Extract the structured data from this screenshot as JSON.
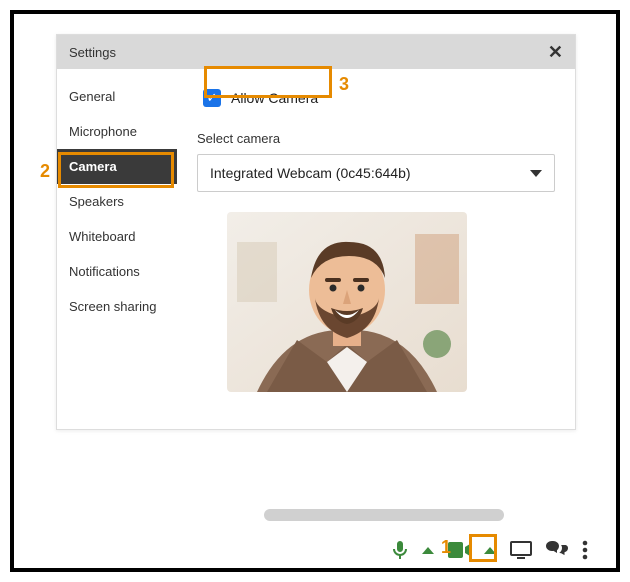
{
  "panel": {
    "title": "Settings",
    "sidebar": [
      {
        "label": "General"
      },
      {
        "label": "Microphone"
      },
      {
        "label": "Camera",
        "active": true
      },
      {
        "label": "Speakers"
      },
      {
        "label": "Whiteboard"
      },
      {
        "label": "Notifications"
      },
      {
        "label": "Screen sharing"
      }
    ],
    "content": {
      "allow_label": "Allow Camera",
      "allow_checked": true,
      "select_label": "Select camera",
      "selected_camera": "Integrated Webcam (0c45:644b)"
    }
  },
  "annotations": {
    "n1": "1",
    "n2": "2",
    "n3": "3"
  }
}
